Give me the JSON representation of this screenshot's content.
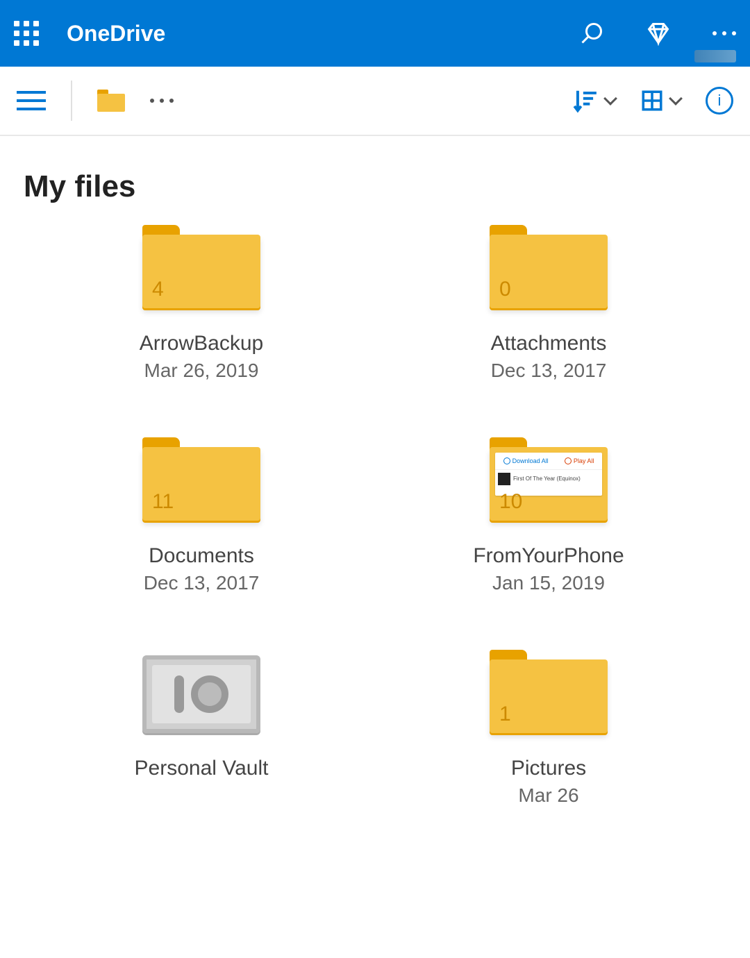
{
  "header": {
    "brand": "OneDrive"
  },
  "page": {
    "title": "My files"
  },
  "files": [
    {
      "name": "ArrowBackup",
      "date": "Mar 26, 2019",
      "count": "4",
      "type": "folder"
    },
    {
      "name": "Attachments",
      "date": "Dec 13, 2017",
      "count": "0",
      "type": "folder"
    },
    {
      "name": "Documents",
      "date": "Dec 13, 2017",
      "count": "11",
      "type": "folder"
    },
    {
      "name": "FromYourPhone",
      "date": "Jan 15, 2019",
      "count": "10",
      "type": "folder-preview"
    },
    {
      "name": "Personal Vault",
      "date": "",
      "count": "",
      "type": "vault"
    },
    {
      "name": "Pictures",
      "date": "Mar 26",
      "count": "1",
      "type": "folder"
    }
  ],
  "preview": {
    "btn1": "Download All",
    "btn2": "Play All",
    "track": "First Of The Year (Equinox)"
  }
}
